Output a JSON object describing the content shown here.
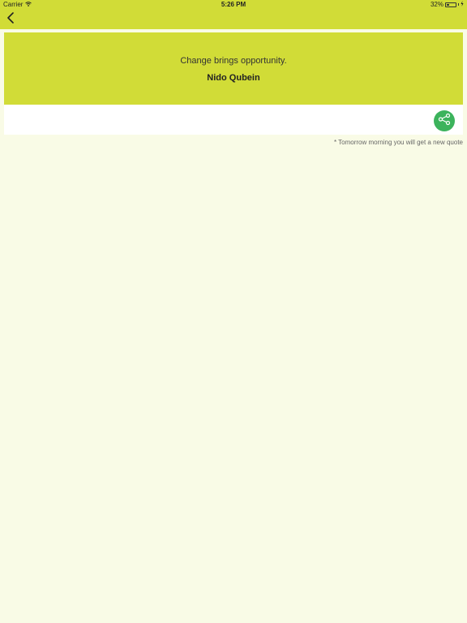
{
  "status_bar": {
    "carrier": "Carrier",
    "time": "5:26 PM",
    "battery": "32%",
    "battery_level": 0.32
  },
  "nav": {
    "back_icon": "chevron-left-icon"
  },
  "quote": {
    "text": "Change brings opportunity.",
    "author": "Nido Qubein"
  },
  "share": {
    "icon": "share-icon"
  },
  "footnote": "* Tomorrow morning you will get a new quote",
  "colors": {
    "accent": "#d1dc37",
    "background": "#f9fbe6",
    "share_button": "#3cb35c"
  }
}
